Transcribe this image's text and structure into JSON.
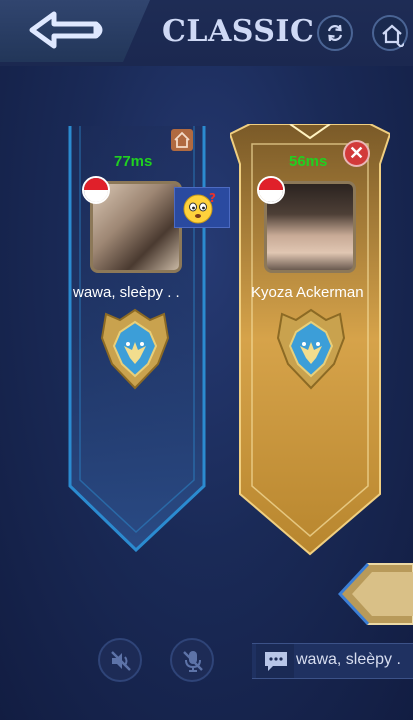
{
  "header": {
    "title": "CLASSIC"
  },
  "players": [
    {
      "ping": "77ms",
      "name": "wawa, sleèpy . .",
      "flag": "indonesia-flag",
      "rank": "rank-emblem"
    },
    {
      "ping": "56ms",
      "name": "Kyoza Ackerman",
      "flag": "indonesia-flag",
      "rank": "rank-emblem"
    }
  ],
  "chat": {
    "last_message": "wawa, sleèpy ."
  },
  "colors": {
    "ping": "#20d020",
    "left_card": "#2b8bd0",
    "right_card": "#d9a84a",
    "background": "#1a2a57"
  }
}
